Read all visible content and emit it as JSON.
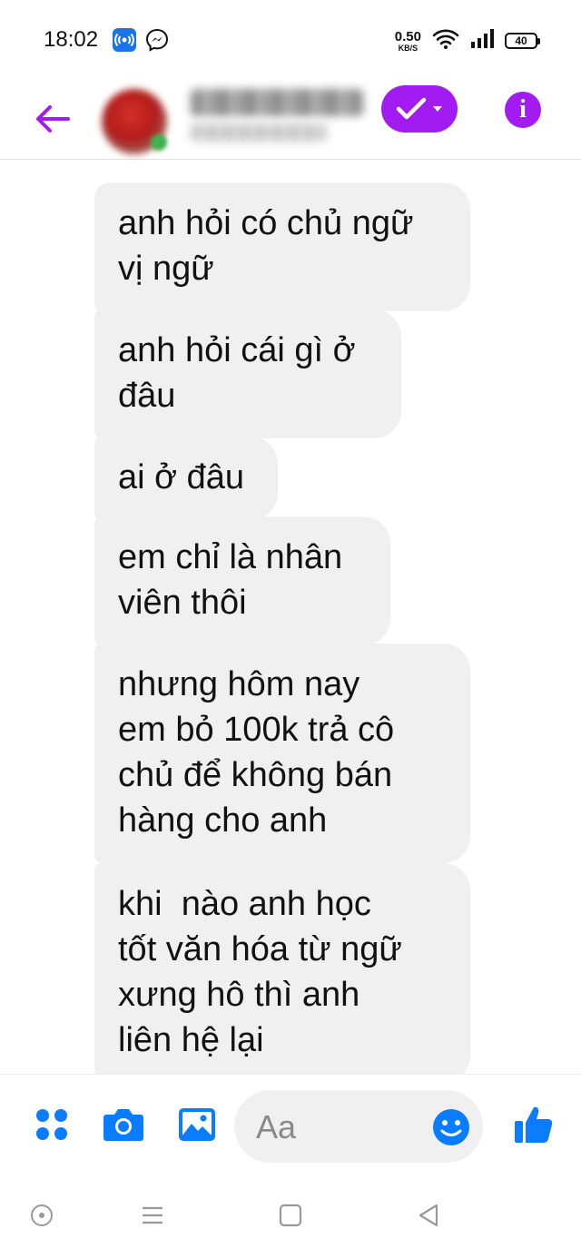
{
  "status_bar": {
    "time": "18:02",
    "net_speed_value": "0.50",
    "net_speed_unit": "KB/S",
    "battery": "40",
    "icons": [
      "wifi-hotspot-icon",
      "messenger-icon",
      "wifi-icon",
      "signal-icon"
    ]
  },
  "header": {
    "back_icon": "arrow-left-icon",
    "contact_name": "",
    "contact_status": "",
    "verify_icon": "check-dropdown-icon",
    "info_icon": "info-icon",
    "accent_color": "#a21cf2"
  },
  "messages": [
    {
      "text": "anh hỏi có chủ ngữ\nvị ngữ"
    },
    {
      "text": "anh hỏi cái gì ở\nđâu"
    },
    {
      "text": "ai ở đâu"
    },
    {
      "text": "em chỉ là nhân\nviên thôi"
    },
    {
      "text": "nhưng hôm nay\nem bỏ 100k trả cô\nchủ để không bán\nhàng cho anh"
    },
    {
      "text": "khi  nào anh học\ntốt văn hóa từ ngữ\nxưng hô thì anh\nliên hệ lại"
    }
  ],
  "composer": {
    "placeholder": "Aa",
    "icons": [
      "menu-dots-icon",
      "camera-icon",
      "gallery-icon",
      "emoji-icon",
      "thumbs-up-icon"
    ],
    "accent_color": "#0a7cff"
  },
  "navbar": {
    "icons": [
      "assistant-icon",
      "recent-apps-icon",
      "home-icon",
      "back-icon"
    ]
  },
  "colors": {
    "bubble_background": "#f0f0f0",
    "text": "#111111"
  }
}
